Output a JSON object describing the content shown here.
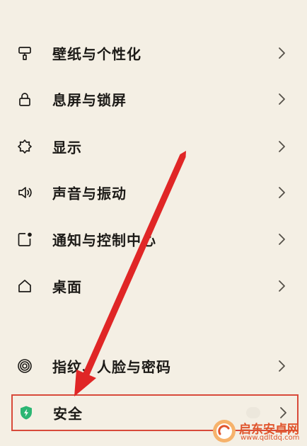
{
  "settings": {
    "items": [
      {
        "label": "壁纸与个性化",
        "icon": "paint-roller-icon"
      },
      {
        "label": "息屏与锁屏",
        "icon": "lock-icon"
      },
      {
        "label": "显示",
        "icon": "brightness-icon"
      },
      {
        "label": "声音与振动",
        "icon": "speaker-icon"
      },
      {
        "label": "通知与控制中心",
        "icon": "notification-icon"
      },
      {
        "label": "桌面",
        "icon": "home-icon"
      },
      {
        "label": "指纹、人脸与密码",
        "icon": "fingerprint-icon"
      },
      {
        "label": "安全",
        "icon": "shield-icon"
      }
    ]
  },
  "colors": {
    "background": "#f4efe4",
    "highlight_border": "#d84a3a",
    "arrow": "#e02626",
    "shield": "#2bb673",
    "watermark": "#e0542c"
  },
  "watermark": {
    "title": "启东安卓网",
    "url": "www.qdltdq.com"
  }
}
